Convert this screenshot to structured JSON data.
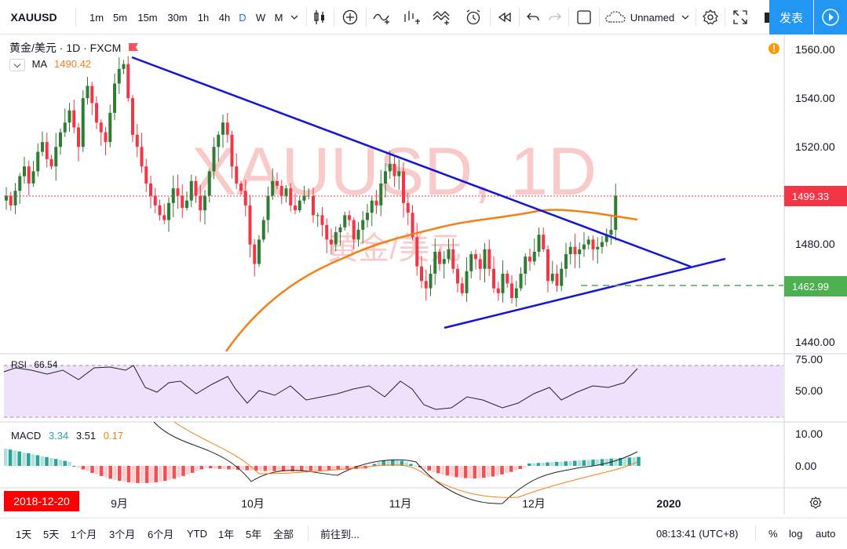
{
  "toolbar": {
    "symbol": "XAUUSD",
    "intervals": [
      "1m",
      "5m",
      "15m",
      "30m",
      "1h",
      "4h",
      "D",
      "W",
      "M"
    ],
    "layout_name": "Unnamed",
    "publish_label": "发表"
  },
  "legend": {
    "symbol_line": "黄金/美元 · 1D · FXCM",
    "ma_label": "MA",
    "ma_value": "1490.42"
  },
  "watermark": {
    "line1": "XAUUSD, 1D",
    "line2": "黄金/美元"
  },
  "price_axis": {
    "ticks": [
      "1560.00",
      "1540.00",
      "1520.00",
      "1500.00",
      "1480.00",
      "1460.00",
      "1440.00"
    ],
    "last_price": "1499.33",
    "level_price": "1462.99"
  },
  "rsi": {
    "label": "RSI",
    "value": "66.54",
    "ticks": [
      "75.00",
      "50.00"
    ]
  },
  "macd": {
    "label": "MACD",
    "hist": "3.34",
    "macd": "3.51",
    "signal": "0.17",
    "ticks": [
      "10.00",
      "0.00"
    ]
  },
  "time_axis": {
    "labels": [
      "9月",
      "10月",
      "11月",
      "12月",
      "2020"
    ],
    "crosshair_date": "2018-12-20"
  },
  "bottom_bar": {
    "ranges": [
      "1天",
      "5天",
      "1个月",
      "3个月",
      "6个月",
      "YTD",
      "1年",
      "5年",
      "全部"
    ],
    "goto_label": "前往到...",
    "clock": "08:13:41 (UTC+8)",
    "percent_label": "%",
    "log_label": "log",
    "auto_label": "auto"
  },
  "colors": {
    "up": "#26a69a",
    "up_candle": "#2e7d32",
    "down_candle": "#f23645",
    "ma": "#f57f17",
    "trendline": "#1515d6",
    "level": "#4caf50",
    "publish": "#2196f3"
  },
  "icons": [
    "candles-icon",
    "add-compare-icon",
    "indicators-icon",
    "templates-icon",
    "alert-icon",
    "replay-icon",
    "undo-icon",
    "redo-icon",
    "fullscreen-box-icon",
    "cloud-icon",
    "settings-icon",
    "expand-icon",
    "camera-icon",
    "play-icon",
    "warning-icon",
    "gear-icon"
  ]
}
